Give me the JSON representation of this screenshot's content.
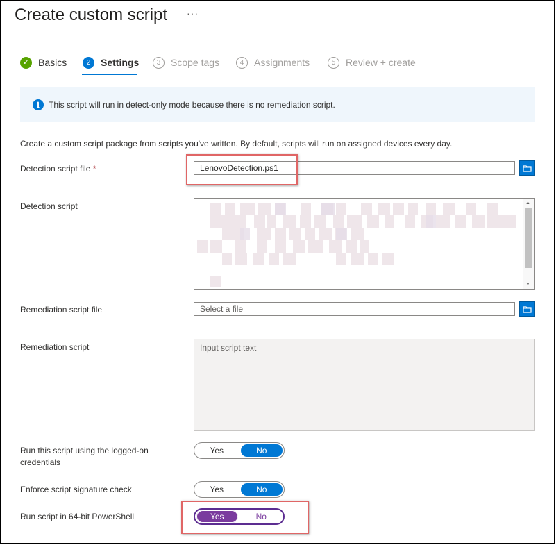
{
  "page": {
    "title": "Create custom script",
    "more_label": "···"
  },
  "steps": [
    {
      "num": "✓",
      "label": "Basics",
      "state": "done"
    },
    {
      "num": "2",
      "label": "Settings",
      "state": "active"
    },
    {
      "num": "3",
      "label": "Scope tags",
      "state": "todo"
    },
    {
      "num": "4",
      "label": "Assignments",
      "state": "todo"
    },
    {
      "num": "5",
      "label": "Review + create",
      "state": "todo"
    }
  ],
  "info_banner": {
    "icon": "info-icon",
    "glyph": "i",
    "text": "This script will run in detect-only mode because there is no remediation script."
  },
  "description": "Create a custom script package from scripts you've written. By default, scripts will run on assigned devices every day.",
  "detection_file": {
    "label": "Detection script file",
    "required_mark": "*",
    "value": "LenovoDetection.ps1"
  },
  "detection_script": {
    "label": "Detection script"
  },
  "remediation_file": {
    "label": "Remediation script file",
    "placeholder": "Select a file"
  },
  "remediation_script": {
    "label": "Remediation script",
    "placeholder": "Input script text"
  },
  "logged_on": {
    "label": "Run this script using the logged-on credentials",
    "yes": "Yes",
    "no": "No",
    "selected": "No"
  },
  "signature_check": {
    "label": "Enforce script signature check",
    "yes": "Yes",
    "no": "No",
    "selected": "No"
  },
  "powershell64": {
    "label": "Run script in 64-bit PowerShell",
    "yes": "Yes",
    "no": "No",
    "selected": "Yes"
  },
  "colors": {
    "accent": "#0078d4",
    "done_green": "#57a300",
    "highlight_red": "#e06666",
    "toggle_purple": "#7a3b9e"
  }
}
